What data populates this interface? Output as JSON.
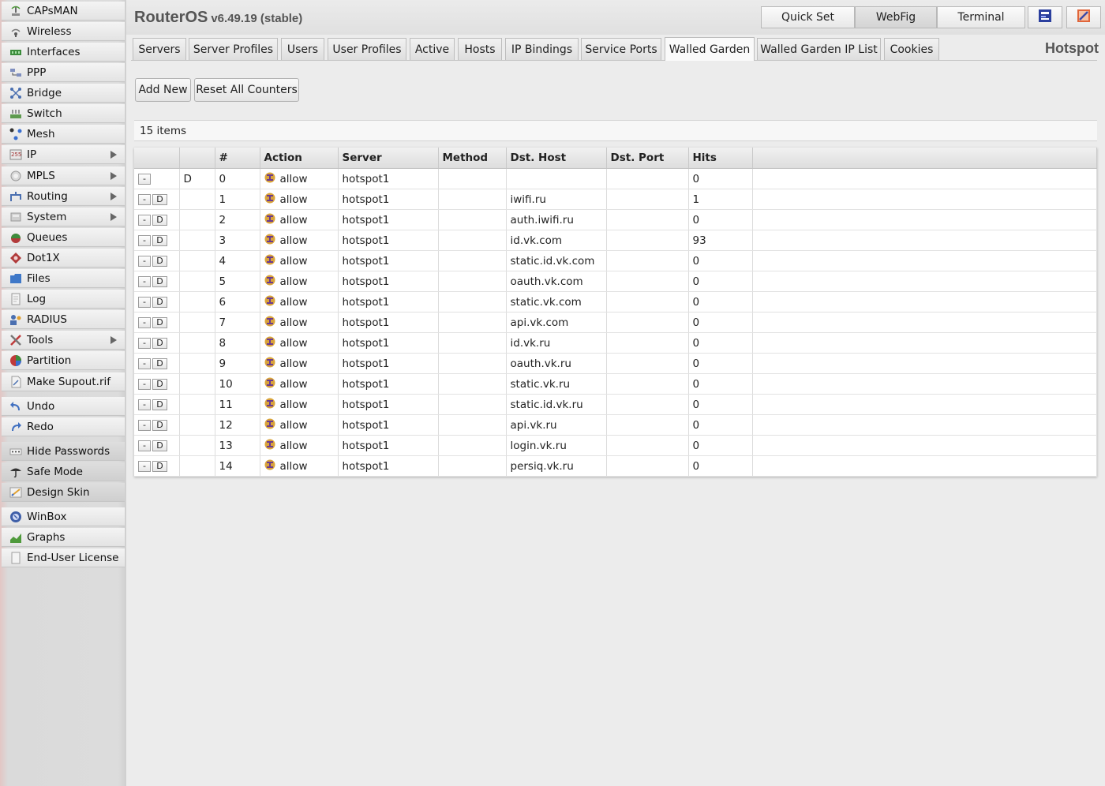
{
  "header": {
    "app_name": "RouterOS",
    "version": "v6.49.19 (stable)",
    "buttons": {
      "quick_set": "Quick Set",
      "webfig": "WebFig",
      "terminal": "Terminal"
    }
  },
  "sidebar": {
    "items": [
      {
        "label": "CAPsMAN",
        "icon": "capsman-icon"
      },
      {
        "label": "Wireless",
        "icon": "wireless-icon"
      },
      {
        "label": "Interfaces",
        "icon": "interfaces-icon"
      },
      {
        "label": "PPP",
        "icon": "ppp-icon"
      },
      {
        "label": "Bridge",
        "icon": "bridge-icon"
      },
      {
        "label": "Switch",
        "icon": "switch-icon"
      },
      {
        "label": "Mesh",
        "icon": "mesh-icon"
      },
      {
        "label": "IP",
        "icon": "ip-icon",
        "submenu": true
      },
      {
        "label": "MPLS",
        "icon": "mpls-icon",
        "submenu": true
      },
      {
        "label": "Routing",
        "icon": "routing-icon",
        "submenu": true
      },
      {
        "label": "System",
        "icon": "system-icon",
        "submenu": true
      },
      {
        "label": "Queues",
        "icon": "queues-icon"
      },
      {
        "label": "Dot1X",
        "icon": "dot1x-icon"
      },
      {
        "label": "Files",
        "icon": "files-icon"
      },
      {
        "label": "Log",
        "icon": "log-icon"
      },
      {
        "label": "RADIUS",
        "icon": "radius-icon"
      },
      {
        "label": "Tools",
        "icon": "tools-icon",
        "submenu": true
      },
      {
        "label": "Partition",
        "icon": "partition-icon"
      },
      {
        "label": "Make Supout.rif",
        "icon": "supout-icon"
      },
      {
        "label": "Undo",
        "icon": "undo-icon"
      },
      {
        "label": "Redo",
        "icon": "redo-icon"
      },
      {
        "label": "Hide Passwords",
        "icon": "hide-passwords-icon"
      },
      {
        "label": "Safe Mode",
        "icon": "safe-mode-icon"
      },
      {
        "label": "Design Skin",
        "icon": "design-skin-icon"
      },
      {
        "label": "WinBox",
        "icon": "winbox-icon"
      },
      {
        "label": "Graphs",
        "icon": "graphs-icon"
      },
      {
        "label": "End-User License",
        "icon": "license-icon"
      }
    ]
  },
  "tabs": [
    "Servers",
    "Server Profiles",
    "Users",
    "User Profiles",
    "Active",
    "Hosts",
    "IP Bindings",
    "Service Ports",
    "Walled Garden",
    "Walled Garden IP List",
    "Cookies"
  ],
  "active_tab": "Walled Garden",
  "section_title": "Hotspot",
  "actions": {
    "add_new": "Add New",
    "reset_counters": "Reset All Counters"
  },
  "item_count": "15 items",
  "table": {
    "columns": [
      "",
      "",
      "#",
      "Action",
      "Server",
      "Method",
      "Dst. Host",
      "Dst. Port",
      "Hits",
      ""
    ],
    "rows": [
      {
        "flag": "D",
        "num": "0",
        "action": "allow",
        "server": "hotspot1",
        "method": "",
        "dst_host": "",
        "dst_port": "",
        "hits": "0",
        "dynamic": true
      },
      {
        "flag": "",
        "num": "1",
        "action": "allow",
        "server": "hotspot1",
        "method": "",
        "dst_host": "iwifi.ru",
        "dst_port": "",
        "hits": "1"
      },
      {
        "flag": "",
        "num": "2",
        "action": "allow",
        "server": "hotspot1",
        "method": "",
        "dst_host": "auth.iwifi.ru",
        "dst_port": "",
        "hits": "0"
      },
      {
        "flag": "",
        "num": "3",
        "action": "allow",
        "server": "hotspot1",
        "method": "",
        "dst_host": "id.vk.com",
        "dst_port": "",
        "hits": "93"
      },
      {
        "flag": "",
        "num": "4",
        "action": "allow",
        "server": "hotspot1",
        "method": "",
        "dst_host": "static.id.vk.com",
        "dst_port": "",
        "hits": "0"
      },
      {
        "flag": "",
        "num": "5",
        "action": "allow",
        "server": "hotspot1",
        "method": "",
        "dst_host": "oauth.vk.com",
        "dst_port": "",
        "hits": "0"
      },
      {
        "flag": "",
        "num": "6",
        "action": "allow",
        "server": "hotspot1",
        "method": "",
        "dst_host": "static.vk.com",
        "dst_port": "",
        "hits": "0"
      },
      {
        "flag": "",
        "num": "7",
        "action": "allow",
        "server": "hotspot1",
        "method": "",
        "dst_host": "api.vk.com",
        "dst_port": "",
        "hits": "0"
      },
      {
        "flag": "",
        "num": "8",
        "action": "allow",
        "server": "hotspot1",
        "method": "",
        "dst_host": "id.vk.ru",
        "dst_port": "",
        "hits": "0"
      },
      {
        "flag": "",
        "num": "9",
        "action": "allow",
        "server": "hotspot1",
        "method": "",
        "dst_host": "oauth.vk.ru",
        "dst_port": "",
        "hits": "0"
      },
      {
        "flag": "",
        "num": "10",
        "action": "allow",
        "server": "hotspot1",
        "method": "",
        "dst_host": "static.vk.ru",
        "dst_port": "",
        "hits": "0"
      },
      {
        "flag": "",
        "num": "11",
        "action": "allow",
        "server": "hotspot1",
        "method": "",
        "dst_host": "static.id.vk.ru",
        "dst_port": "",
        "hits": "0"
      },
      {
        "flag": "",
        "num": "12",
        "action": "allow",
        "server": "hotspot1",
        "method": "",
        "dst_host": "api.vk.ru",
        "dst_port": "",
        "hits": "0"
      },
      {
        "flag": "",
        "num": "13",
        "action": "allow",
        "server": "hotspot1",
        "method": "",
        "dst_host": "login.vk.ru",
        "dst_port": "",
        "hits": "0"
      },
      {
        "flag": "",
        "num": "14",
        "action": "allow",
        "server": "hotspot1",
        "method": "",
        "dst_host": "persiq.vk.ru",
        "dst_port": "",
        "hits": "0"
      }
    ],
    "row_buttons": {
      "disable": "-",
      "dynamic": "D"
    }
  },
  "colors": {
    "allow_icon": "#d9a33a",
    "allow_icon_stripe": "#6b3b8e",
    "sidebar_edge": "#e2c6c4"
  }
}
